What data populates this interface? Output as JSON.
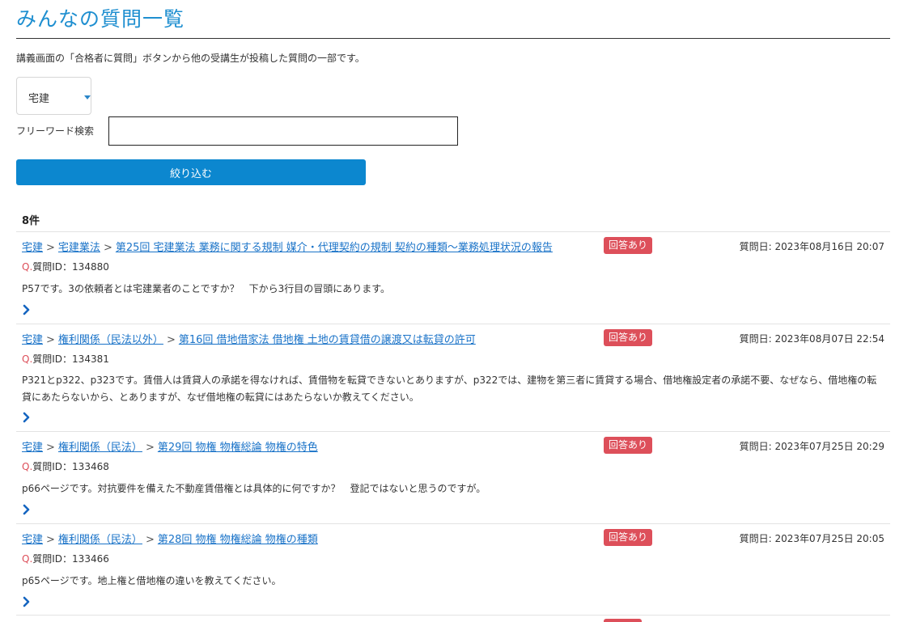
{
  "page": {
    "title": "みんなの質問一覧",
    "intro": "講義画面の「合格者に質問」ボタンから他の受講生が投稿した質問の一部です。"
  },
  "filter": {
    "category_value": "宅建",
    "keyword_label": "フリーワード検索",
    "keyword_value": "",
    "submit_label": "絞り込む"
  },
  "results": {
    "count_label": "8件",
    "items": [
      {
        "crumbs": [
          "宅建",
          "宅建業法",
          "第25回 宅建業法 業務に関する規制 媒介・代理契約の規制 契約の種類〜業務処理状況の報告"
        ],
        "separator": ">",
        "status": "回答あり",
        "date": "質問日: 2023年08月16日 20:07",
        "qid_prefix": "Q.",
        "qid": "質問ID：134880",
        "body": "P57です。3の依頼者とは宅建業者のことですか？　下から3行目の冒頭にあります。"
      },
      {
        "crumbs": [
          "宅建",
          "権利関係（民法以外）",
          "第16回 借地借家法 借地権 土地の賃貸借の譲渡又は転貸の許可"
        ],
        "separator": ">",
        "status": "回答あり",
        "date": "質問日: 2023年08月07日 22:54",
        "qid_prefix": "Q.",
        "qid": "質問ID：134381",
        "body": "P321とp322、p323です。賃借人は賃貸人の承諾を得なければ、賃借物を転貸できないとありますが、p322では、建物を第三者に賃貸する場合、借地権設定者の承諾不要、なぜなら、借地権の転貸にあたらないから、とありますが、なぜ借地権の転貸にはあたらないか教えてください。"
      },
      {
        "crumbs": [
          "宅建",
          "権利関係（民法）",
          "第29回 物権 物権総論 物権の特色"
        ],
        "separator": ">",
        "status": "回答あり",
        "date": "質問日: 2023年07月25日 20:29",
        "qid_prefix": "Q.",
        "qid": "質問ID：133468",
        "body": "p66ページです。対抗要件を備えた不動産賃借権とは具体的に何ですか？　登記ではないと思うのですが。"
      },
      {
        "crumbs": [
          "宅建",
          "権利関係（民法）",
          "第28回 物権 物権総論 物権の種類"
        ],
        "separator": ">",
        "status": "回答あり",
        "date": "質問日: 2023年07月25日 20:05",
        "qid_prefix": "Q.",
        "qid": "質問ID：133466",
        "body": "p65ページです。地上権と借地権の違いを教えてください。"
      }
    ]
  },
  "colors": {
    "title": "#1f8fd0",
    "primary_button": "#0c87cf",
    "link": "#1a73c8",
    "badge": "#dd4f5a",
    "chevron": "#1565c0"
  },
  "icons": {
    "more": "chevron-right-icon",
    "select_caret": "caret-down-icon"
  }
}
